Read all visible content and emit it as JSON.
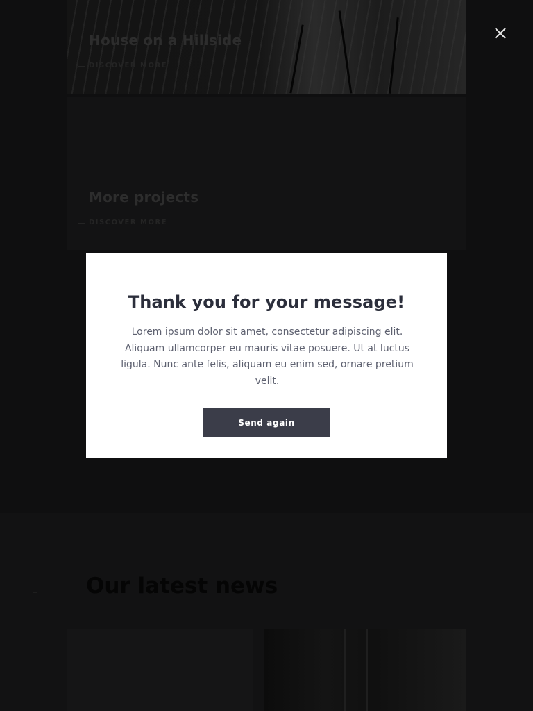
{
  "background": {
    "projects": [
      {
        "title": "House on a Hillside",
        "link": "DISCOVER MORE"
      },
      {
        "title": "More projects",
        "link": "DISCOVER MORE"
      }
    ],
    "news": {
      "title": "Our latest news"
    }
  },
  "dialog": {
    "title": "Thank you for your message!",
    "message": "Lorem ipsum dolor sit amet, consectetur adipiscing elit. Aliquam ullamcorper eu mauris vitae posuere. Ut at luctus ligula. Nunc ante felis, aliquam eu enim sed, ornare pretium velit.",
    "button_label": "Send again",
    "close_icon": "close-icon"
  },
  "colors": {
    "overlay": "#0b0b0c",
    "modal_bg": "#ffffff",
    "heading": "#2b2e3b",
    "body_text": "#5e6170",
    "button_bg": "#3b3d49",
    "button_text": "#ffffff",
    "close_icon": "#e9e9e9"
  }
}
